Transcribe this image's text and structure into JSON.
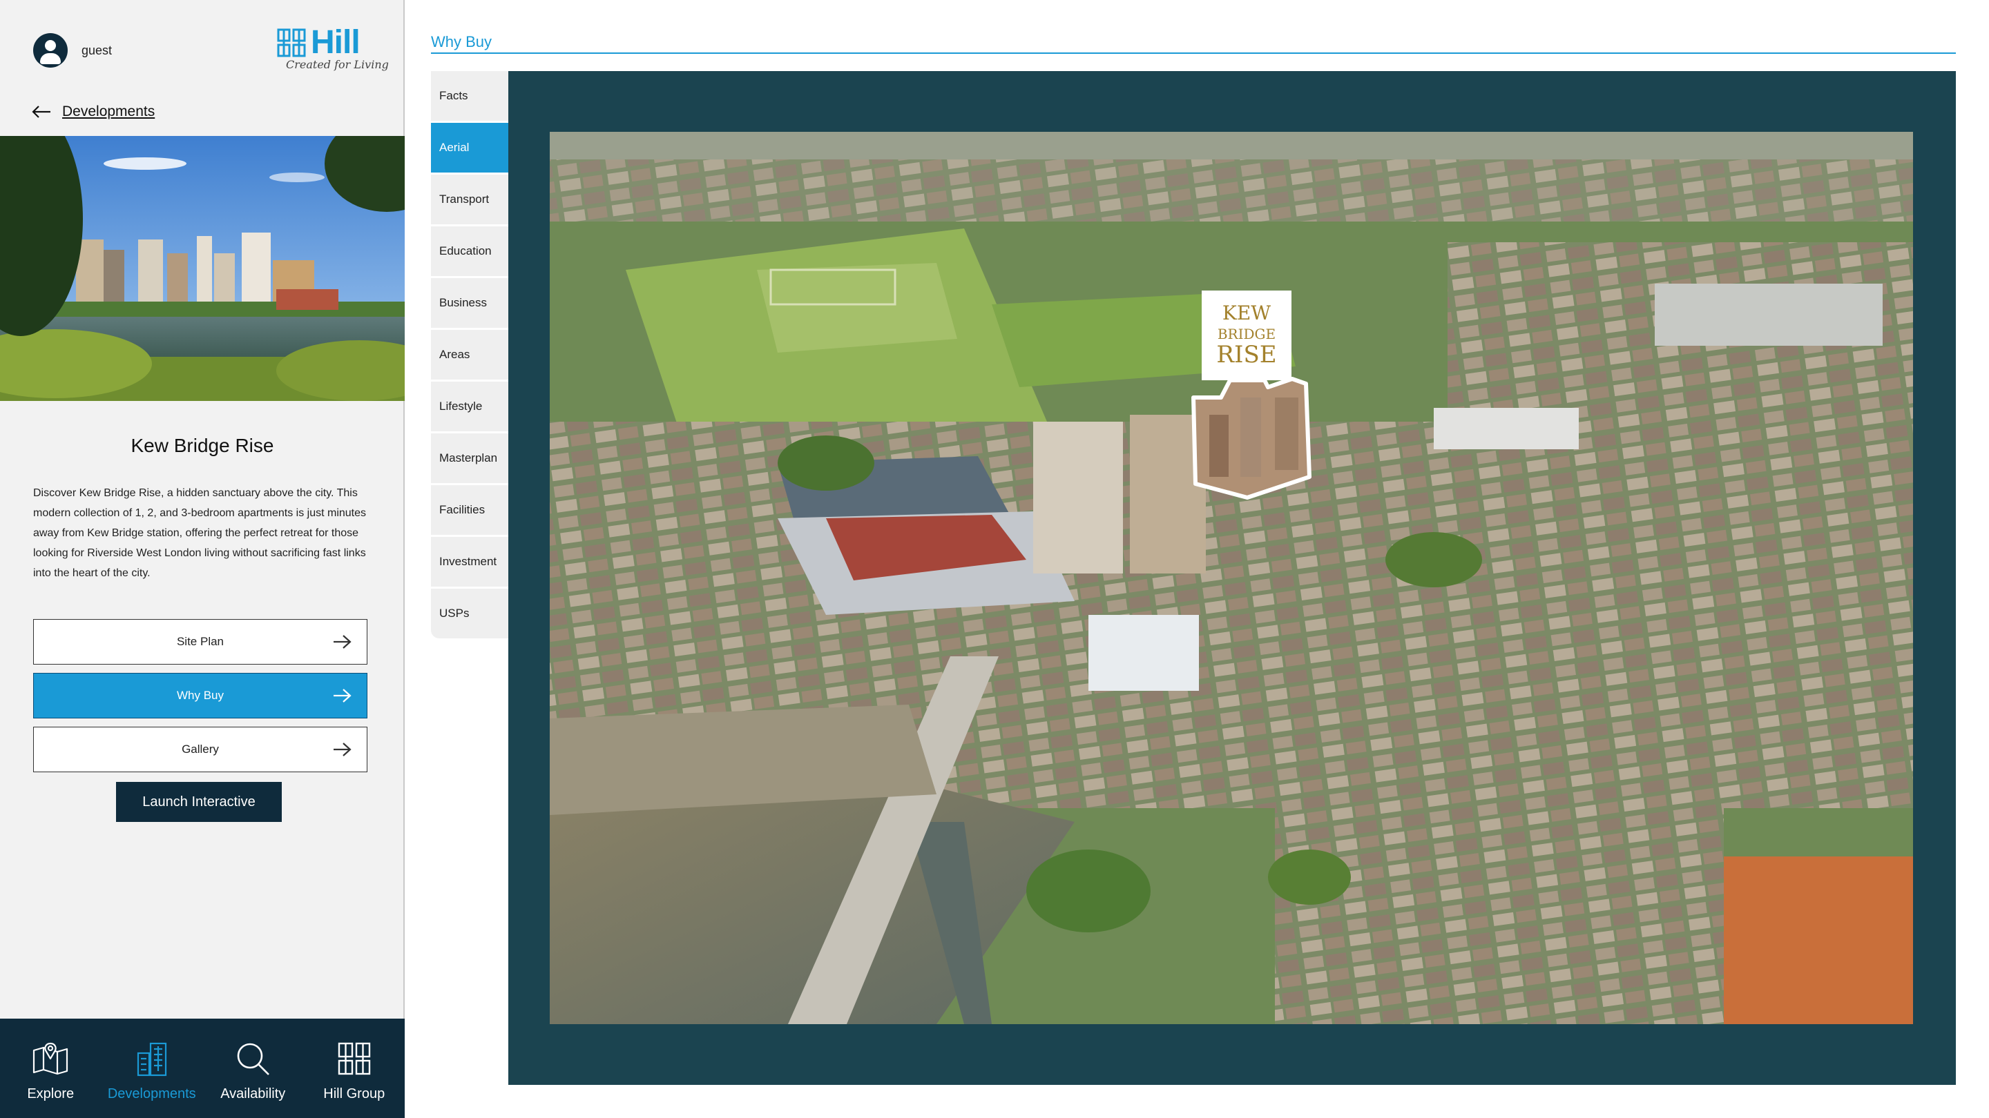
{
  "user": {
    "name": "guest"
  },
  "brand": {
    "name": "Hill",
    "tagline": "Created for Living",
    "accent": "#1a9ad6",
    "dark": "#0f2b3c",
    "panel": "#1b4450"
  },
  "back": {
    "label": "Developments",
    "icon": "arrow-left-icon"
  },
  "development": {
    "title": "Kew Bridge Rise",
    "description": "Discover Kew Bridge Rise, a hidden sanctuary above the city. This modern collection of 1, 2, and 3-bedroom apartments is just minutes away from Kew Bridge station, offering the perfect retreat for those looking for Riverside West London living without sacrificing fast links into the heart of the city."
  },
  "actions": [
    {
      "label": "Site Plan",
      "active": false,
      "icon": "arrow-right-icon"
    },
    {
      "label": "Why Buy",
      "active": true,
      "icon": "arrow-right-icon"
    },
    {
      "label": "Gallery",
      "active": false,
      "icon": "arrow-right-icon"
    }
  ],
  "launch": {
    "label": "Launch Interactive"
  },
  "bottom_nav": [
    {
      "label": "Explore",
      "icon": "map-icon",
      "active": false
    },
    {
      "label": "Developments",
      "icon": "buildings-icon",
      "active": true
    },
    {
      "label": "Availability",
      "icon": "search-icon",
      "active": false
    },
    {
      "label": "Hill Group",
      "icon": "hill-logo-icon",
      "active": false
    }
  ],
  "main": {
    "breadcrumb": "Why Buy",
    "tabs": [
      "Facts",
      "Aerial",
      "Transport",
      "Education",
      "Business",
      "Areas",
      "Lifestyle",
      "Masterplan",
      "Facilities",
      "Investment",
      "USPs"
    ],
    "active_tab": "Aerial",
    "aerial_badge": {
      "line1": "KEW",
      "line2": "BRIDGE",
      "line3": "RISE"
    }
  }
}
